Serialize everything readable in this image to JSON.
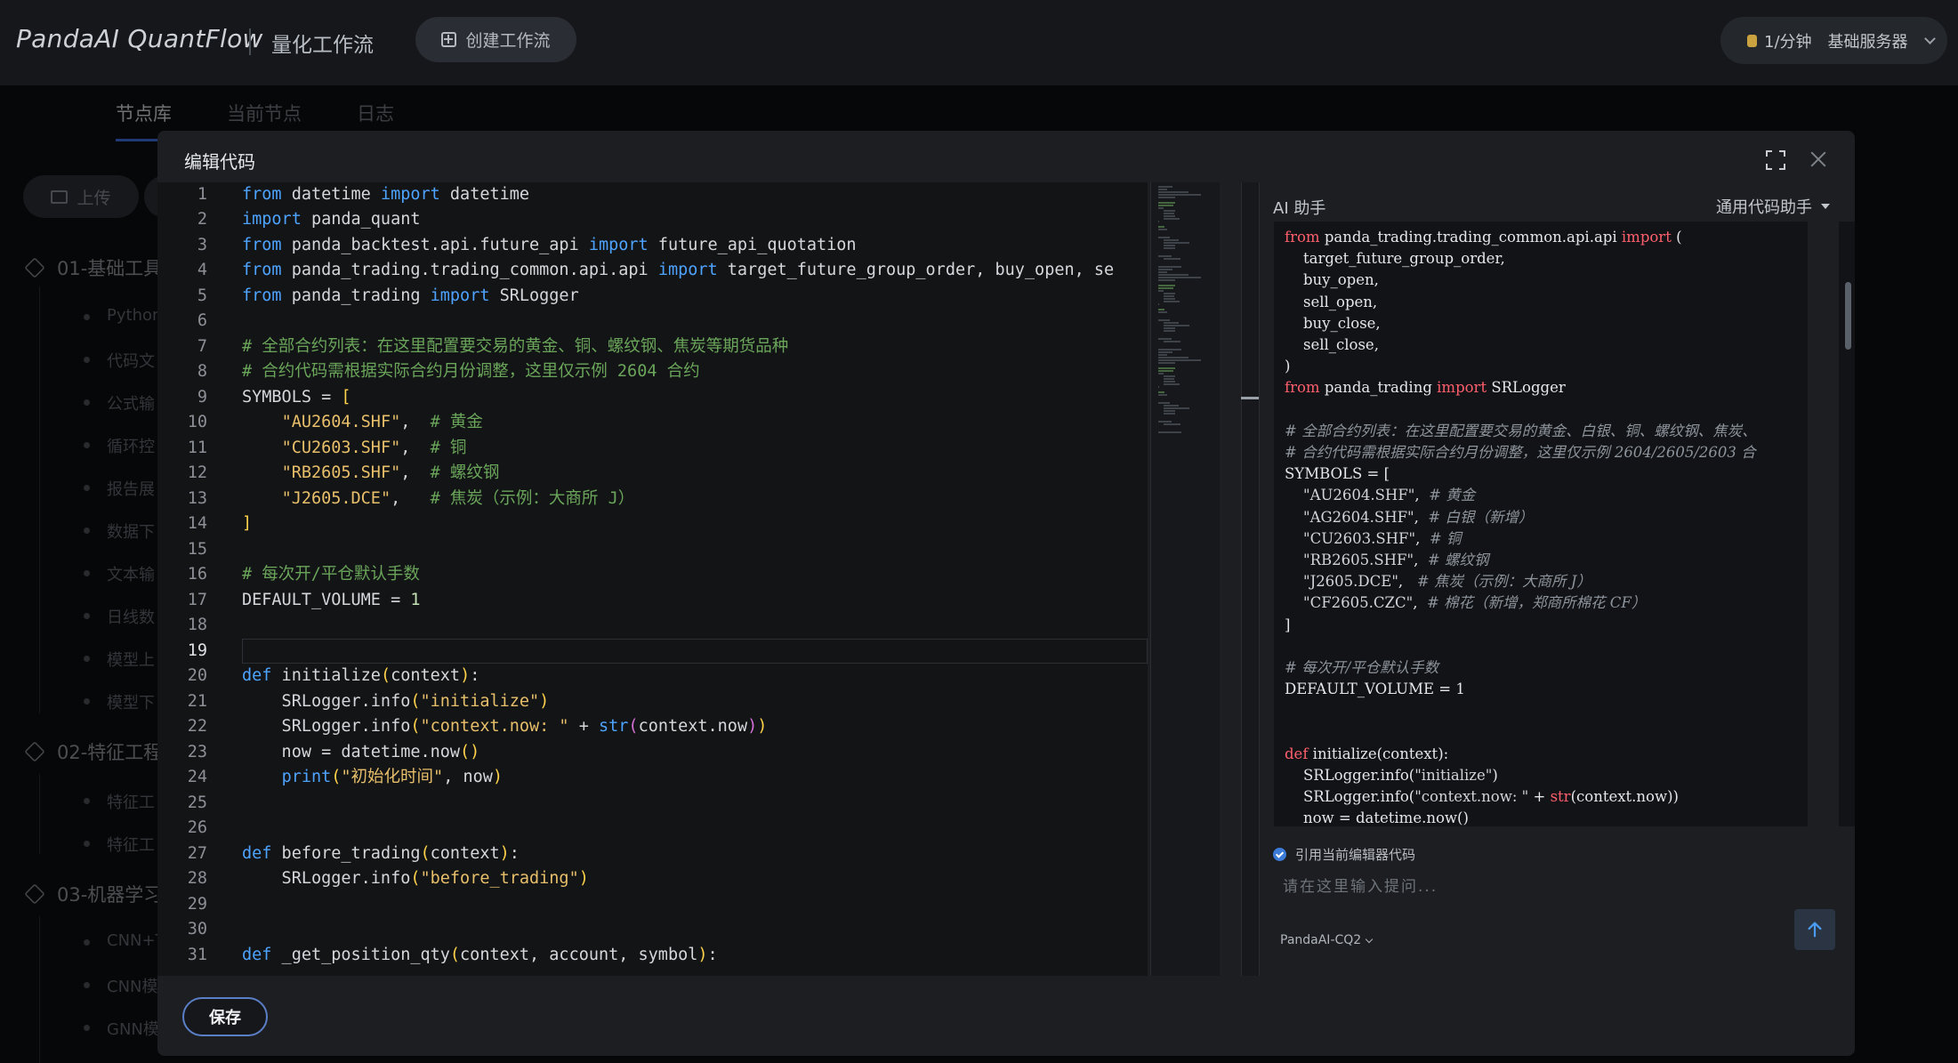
{
  "app": {
    "brand": "PandaAI QuantFlow",
    "subtitle": "量化工作流",
    "create_workflow_label": "创建工作流",
    "server_rate": "1/分钟",
    "server_name": "基础服务器"
  },
  "background_sidebar": {
    "tabs": [
      "节点库",
      "当前节点",
      "日志"
    ],
    "upload_label": "上传",
    "groups": [
      {
        "label": "01-基础工具",
        "items": [
          "Python",
          "代码文",
          "公式输",
          "循环控",
          "报告展",
          "数据下",
          "文本输",
          "日线数",
          "模型上",
          "模型下"
        ]
      },
      {
        "label": "02-特征工程",
        "items": [
          "特征工",
          "特征工"
        ]
      },
      {
        "label": "03-机器学习",
        "items": [
          "CNN+T",
          "CNN模",
          "GNN模"
        ]
      }
    ]
  },
  "modal": {
    "title": "编辑代码",
    "save_label": "保存"
  },
  "editor": {
    "current_line": 19,
    "lines": [
      [
        [
          "kw",
          "from"
        ],
        [
          "t",
          " datetime "
        ],
        [
          "kw",
          "import"
        ],
        [
          "t",
          " datetime"
        ]
      ],
      [
        [
          "kw",
          "import"
        ],
        [
          "t",
          " panda_quant"
        ]
      ],
      [
        [
          "kw",
          "from"
        ],
        [
          "t",
          " panda_backtest.api.future_api "
        ],
        [
          "kw",
          "import"
        ],
        [
          "t",
          " future_api_quotation"
        ]
      ],
      [
        [
          "kw",
          "from"
        ],
        [
          "t",
          " panda_trading.trading_common.api.api "
        ],
        [
          "kw",
          "import"
        ],
        [
          "t",
          " target_future_group_order, buy_open, se"
        ]
      ],
      [
        [
          "kw",
          "from"
        ],
        [
          "t",
          " panda_trading "
        ],
        [
          "kw",
          "import"
        ],
        [
          "t",
          " SRLogger"
        ]
      ],
      [],
      [
        [
          "cm",
          "# 全部合约列表：在这里配置要交易的黄金、铜、螺纹钢、焦炭等期货品种"
        ]
      ],
      [
        [
          "cm",
          "# 合约代码需根据实际合约月份调整，这里仅示例 2604 合约"
        ]
      ],
      [
        [
          "t",
          "SYMBOLS = "
        ],
        [
          "br1",
          "["
        ]
      ],
      [
        [
          "t",
          "    "
        ],
        [
          "str",
          "\"AU2604.SHF\""
        ],
        [
          "t",
          ",  "
        ],
        [
          "cm",
          "# 黄金"
        ]
      ],
      [
        [
          "t",
          "    "
        ],
        [
          "str",
          "\"CU2603.SHF\""
        ],
        [
          "t",
          ",  "
        ],
        [
          "cm",
          "# 铜"
        ]
      ],
      [
        [
          "t",
          "    "
        ],
        [
          "str",
          "\"RB2605.SHF\""
        ],
        [
          "t",
          ",  "
        ],
        [
          "cm",
          "# 螺纹钢"
        ]
      ],
      [
        [
          "t",
          "    "
        ],
        [
          "str",
          "\"J2605.DCE\""
        ],
        [
          "t",
          ",   "
        ],
        [
          "cm",
          "# 焦炭（示例：大商所 J）"
        ]
      ],
      [
        [
          "br1",
          "]"
        ]
      ],
      [],
      [
        [
          "cm",
          "# 每次开/平仓默认手数"
        ]
      ],
      [
        [
          "t",
          "DEFAULT_VOLUME = "
        ],
        [
          "num",
          "1"
        ]
      ],
      [],
      [],
      [
        [
          "kw",
          "def"
        ],
        [
          "t",
          " initialize"
        ],
        [
          "br1",
          "("
        ],
        [
          "t",
          "context"
        ],
        [
          "br1",
          ")"
        ],
        [
          "t",
          ":"
        ]
      ],
      [
        [
          "t",
          "    SRLogger.info"
        ],
        [
          "br1",
          "("
        ],
        [
          "str",
          "\"initialize\""
        ],
        [
          "br1",
          ")"
        ]
      ],
      [
        [
          "t",
          "    SRLogger.info"
        ],
        [
          "br1",
          "("
        ],
        [
          "str",
          "\"context.now: \""
        ],
        [
          "t",
          " + "
        ],
        [
          "fn",
          "str"
        ],
        [
          "br2",
          "("
        ],
        [
          "t",
          "context.now"
        ],
        [
          "br2",
          ")"
        ],
        [
          "br1",
          ")"
        ]
      ],
      [
        [
          "t",
          "    now = datetime.now"
        ],
        [
          "br1",
          "()"
        ]
      ],
      [
        [
          "t",
          "    "
        ],
        [
          "fn",
          "print"
        ],
        [
          "br1",
          "("
        ],
        [
          "str",
          "\"初始化时间\""
        ],
        [
          "t",
          ", now"
        ],
        [
          "br1",
          ")"
        ]
      ],
      [],
      [],
      [
        [
          "kw",
          "def"
        ],
        [
          "t",
          " before_trading"
        ],
        [
          "br1",
          "("
        ],
        [
          "t",
          "context"
        ],
        [
          "br1",
          ")"
        ],
        [
          "t",
          ":"
        ]
      ],
      [
        [
          "t",
          "    SRLogger.info"
        ],
        [
          "br1",
          "("
        ],
        [
          "str",
          "\"before_trading\""
        ],
        [
          "br1",
          ")"
        ]
      ],
      [],
      [],
      [
        [
          "kw",
          "def"
        ],
        [
          "t",
          " _get_position_qty"
        ],
        [
          "br1",
          "("
        ],
        [
          "t",
          "context, account, symbol"
        ],
        [
          "br1",
          ")"
        ],
        [
          "t",
          ":"
        ]
      ]
    ]
  },
  "ai_assistant": {
    "title": "AI 助手",
    "helper_select": "通用代码助手",
    "reference_label": "引用当前编辑器代码",
    "input_placeholder": "请在这里输入提问...",
    "model": "PandaAI-CQ2",
    "code_lines": [
      [
        [
          "kw",
          "from"
        ],
        [
          "t",
          " panda_trading.trading_common.api.api "
        ],
        [
          "kw",
          "import"
        ],
        [
          "t",
          " ("
        ]
      ],
      [
        [
          "t",
          "    target_future_group_order,"
        ]
      ],
      [
        [
          "t",
          "    buy_open,"
        ]
      ],
      [
        [
          "t",
          "    sell_open,"
        ]
      ],
      [
        [
          "t",
          "    buy_close,"
        ]
      ],
      [
        [
          "t",
          "    sell_close,"
        ]
      ],
      [
        [
          "t",
          ")"
        ]
      ],
      [
        [
          "kw",
          "from"
        ],
        [
          "t",
          " panda_trading "
        ],
        [
          "kw",
          "import"
        ],
        [
          "t",
          " SRLogger"
        ]
      ],
      [],
      [
        [
          "cm",
          "# 全部合约列表：在这里配置要交易的黄金、白银、铜、螺纹钢、焦炭、"
        ]
      ],
      [
        [
          "cm",
          "# 合约代码需根据实际合约月份调整，这里仅示例 2604/2605/2603 合"
        ]
      ],
      [
        [
          "t",
          "SYMBOLS = ["
        ]
      ],
      [
        [
          "t",
          "    "
        ],
        [
          "str",
          "\"AU2604.SHF\""
        ],
        [
          "t",
          ",  "
        ],
        [
          "cm",
          "# 黄金"
        ]
      ],
      [
        [
          "t",
          "    "
        ],
        [
          "str",
          "\"AG2604.SHF\""
        ],
        [
          "t",
          ",  "
        ],
        [
          "cm",
          "# 白银（新增）"
        ]
      ],
      [
        [
          "t",
          "    "
        ],
        [
          "str",
          "\"CU2603.SHF\""
        ],
        [
          "t",
          ",  "
        ],
        [
          "cm",
          "# 铜"
        ]
      ],
      [
        [
          "t",
          "    "
        ],
        [
          "str",
          "\"RB2605.SHF\""
        ],
        [
          "t",
          ",  "
        ],
        [
          "cm",
          "# 螺纹钢"
        ]
      ],
      [
        [
          "t",
          "    "
        ],
        [
          "str",
          "\"J2605.DCE\""
        ],
        [
          "t",
          ",   "
        ],
        [
          "cm",
          "# 焦炭（示例：大商所 J）"
        ]
      ],
      [
        [
          "t",
          "    "
        ],
        [
          "str",
          "\"CF2605.CZC\""
        ],
        [
          "t",
          ",  "
        ],
        [
          "cm",
          "# 棉花（新增，郑商所棉花 CF）"
        ]
      ],
      [
        [
          "t",
          "]"
        ]
      ],
      [],
      [
        [
          "cm",
          "# 每次开/平仓默认手数"
        ]
      ],
      [
        [
          "t",
          "DEFAULT_VOLUME = 1"
        ]
      ],
      [],
      [],
      [
        [
          "kw",
          "def"
        ],
        [
          "t",
          " initialize(context):"
        ]
      ],
      [
        [
          "t",
          "    SRLogger.info("
        ],
        [
          "str",
          "\"initialize\""
        ],
        [
          "t",
          ")"
        ]
      ],
      [
        [
          "t",
          "    SRLogger.info("
        ],
        [
          "str",
          "\"context.now: \""
        ],
        [
          "t",
          " + "
        ],
        [
          "fn",
          "str"
        ],
        [
          "t",
          "(context.now))"
        ]
      ],
      [
        [
          "t",
          "    now = datetime.now()"
        ]
      ]
    ]
  }
}
